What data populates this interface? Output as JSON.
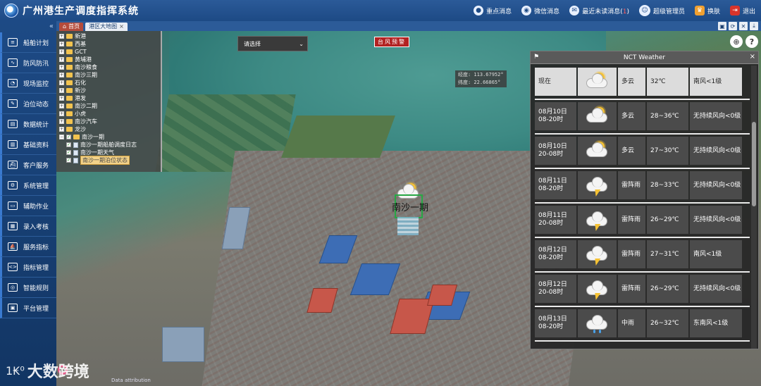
{
  "app": {
    "title": "广州港生产调度指挥系统"
  },
  "topbar": {
    "actions": [
      {
        "label": "重点消息",
        "icon": "bell-icon"
      },
      {
        "label": "微信消息",
        "icon": "wechat-icon"
      },
      {
        "label": "最近未读消息(",
        "count": "1",
        "suffix": ")",
        "icon": "message-icon"
      },
      {
        "label": "超级管理员",
        "icon": "user-avatar-icon"
      },
      {
        "label": "换肤",
        "icon": "skin-icon"
      },
      {
        "label": "退出",
        "icon": "logout-icon"
      }
    ],
    "colors": {
      "skin": "#f0a030",
      "logout": "#d9342b"
    }
  },
  "sidebar": {
    "collapse": "«",
    "items": [
      {
        "label": "船舶计划",
        "icon": "ship-plan-icon"
      },
      {
        "label": "防风防汛",
        "icon": "wind-icon"
      },
      {
        "label": "现场监控",
        "icon": "monitor-icon"
      },
      {
        "label": "泊位动态",
        "icon": "berth-icon"
      },
      {
        "label": "数据统计",
        "icon": "stats-icon"
      },
      {
        "label": "基础资料",
        "icon": "book-icon"
      },
      {
        "label": "客户服务",
        "icon": "service-icon"
      },
      {
        "label": "系统管理",
        "icon": "system-icon"
      },
      {
        "label": "辅助作业",
        "icon": "assist-icon"
      },
      {
        "label": "录入考核",
        "icon": "grid-icon"
      },
      {
        "label": "服务指标",
        "icon": "ship-icon"
      },
      {
        "label": "指标管理",
        "icon": "code-icon"
      },
      {
        "label": "智能规则",
        "icon": "rules-icon"
      },
      {
        "label": "平台管理",
        "icon": "platform-icon"
      }
    ]
  },
  "watermark": {
    "mark": "1₭⁰",
    "text": "大数跨境"
  },
  "tabs": [
    {
      "label": "首页",
      "type": "home"
    },
    {
      "label": "港区大地图",
      "close": "×"
    }
  ],
  "tab_tools": [
    "▣",
    "⟳",
    "✕",
    "⤓"
  ],
  "layer_tree": [
    {
      "label": "新港",
      "level": 0
    },
    {
      "label": "西基",
      "level": 0
    },
    {
      "label": "GCT",
      "level": 0
    },
    {
      "label": "黄埔港",
      "level": 0
    },
    {
      "label": "南沙粮食",
      "level": 0
    },
    {
      "label": "南沙三期",
      "level": 0
    },
    {
      "label": "石化",
      "level": 0
    },
    {
      "label": "新沙",
      "level": 0
    },
    {
      "label": "港发",
      "level": 0
    },
    {
      "label": "南沙二期",
      "level": 0
    },
    {
      "label": "小虎",
      "level": 0
    },
    {
      "label": "南沙汽车",
      "level": 0
    },
    {
      "label": "龙沙",
      "level": 0
    },
    {
      "label": "南沙一期",
      "level": 0,
      "expanded": true
    },
    {
      "label": "南沙一期船舶调度日志",
      "level": 1,
      "checked": true
    },
    {
      "label": "南沙一期天气",
      "level": 1,
      "checked": true
    },
    {
      "label": "南沙一期泊位状态",
      "level": 1,
      "checked": true,
      "selected": true
    }
  ],
  "map": {
    "select_placeholder": "请选择",
    "warning_button": "台风预警",
    "coord": {
      "lon": "经度:  113.67952°",
      "lat": "纬度:   22.66865°"
    },
    "marker_label": "南沙一期",
    "attribution": "Data attribution"
  },
  "weather": {
    "title": "NCT Weather",
    "close": "×",
    "rows": [
      {
        "time": "现在",
        "icon": "partly-cloudy",
        "desc": "多云",
        "temp": "32℃",
        "wind": "南风<1级",
        "now": true
      },
      {
        "time": "08月10日 08-20时",
        "icon": "partly-cloudy",
        "desc": "多云",
        "temp": "28~36℃",
        "wind": "无持续风向<0级"
      },
      {
        "time": "08月10日 20-08时",
        "icon": "partly-cloudy",
        "desc": "多云",
        "temp": "27~30℃",
        "wind": "无持续风向<0级"
      },
      {
        "time": "08月11日 08-20时",
        "icon": "thunderstorm",
        "desc": "雷阵雨",
        "temp": "28~33℃",
        "wind": "无持续风向<0级"
      },
      {
        "time": "08月11日 20-08时",
        "icon": "thunderstorm",
        "desc": "雷阵雨",
        "temp": "26~29℃",
        "wind": "无持续风向<0级"
      },
      {
        "time": "08月12日 08-20时",
        "icon": "thunderstorm",
        "desc": "雷阵雨",
        "temp": "27~31℃",
        "wind": "南风<1级"
      },
      {
        "time": "08月12日 20-08时",
        "icon": "thunderstorm",
        "desc": "雷阵雨",
        "temp": "26~29℃",
        "wind": "无持续风向<0级"
      },
      {
        "time": "08月13日 08-20时",
        "icon": "rain",
        "desc": "中雨",
        "temp": "26~32℃",
        "wind": "东南风<1级"
      }
    ]
  }
}
